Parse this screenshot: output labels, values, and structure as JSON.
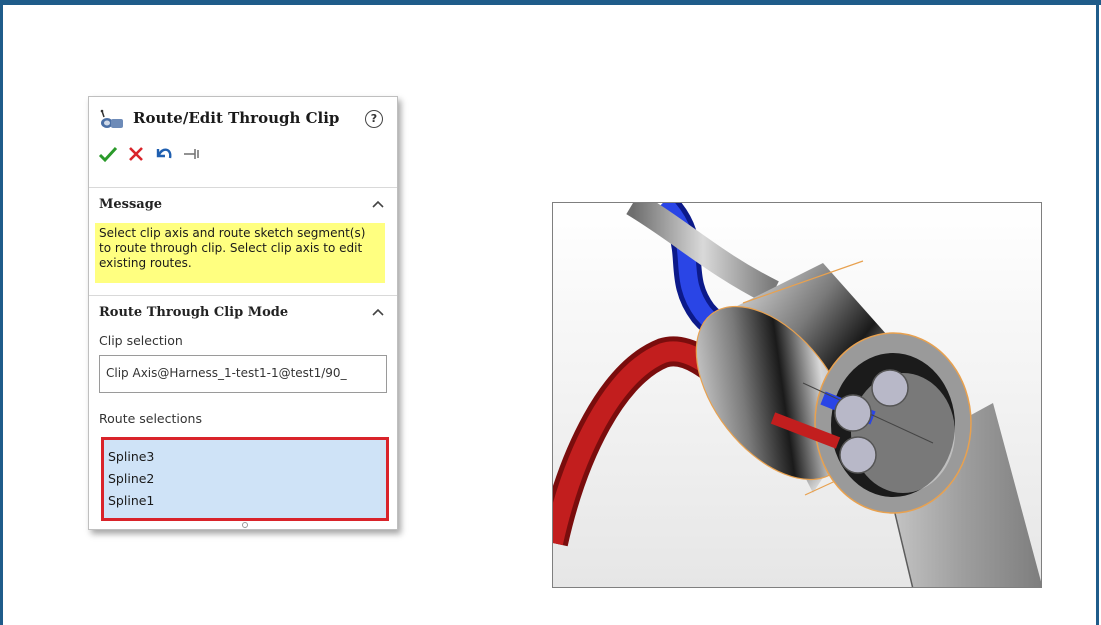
{
  "property_manager": {
    "title": "Route/Edit Through Clip",
    "title_icon": "route-clip-icon",
    "help_icon": "help-icon",
    "help_label": "?",
    "actions": {
      "ok_icon": "checkmark-icon",
      "cancel_icon": "close-icon",
      "undo_icon": "undo-icon",
      "pin_icon": "pin-icon"
    },
    "message_section": {
      "header": "Message",
      "text": "Select clip axis and route sketch segment(s) to route through clip. Select clip axis to edit existing routes."
    },
    "mode_section": {
      "header": "Route Through Clip Mode",
      "clip_selection_label": "Clip selection",
      "clip_selection_value": "Clip Axis@Harness_1-test1-1@test1/90_",
      "route_selections_label": "Route selections",
      "route_selections": [
        "Spline3",
        "Spline2",
        "Spline1"
      ]
    }
  },
  "colors": {
    "frame": "#1f5c8a",
    "message_bg": "#ffff80",
    "list_bg": "#cfe3f7",
    "highlight_border": "#d9232a",
    "ok_green": "#2a9a2a",
    "cancel_red": "#d9232a",
    "wire_red": "#b01818",
    "wire_blue": "#1a2fd1",
    "clip_edge": "#e8a14f"
  }
}
